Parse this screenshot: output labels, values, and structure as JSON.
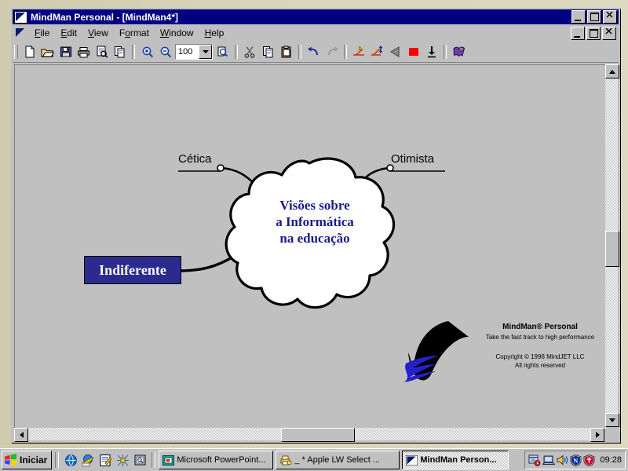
{
  "window": {
    "title": "MindMan Personal - [MindMan4*]",
    "app_icon": "dolphin-icon",
    "buttons": {
      "minimize": "_",
      "maximize": "□",
      "close": "✕"
    }
  },
  "menu": {
    "items": [
      {
        "label": "File",
        "mnemonic": "F"
      },
      {
        "label": "Edit",
        "mnemonic": "E"
      },
      {
        "label": "View",
        "mnemonic": "V"
      },
      {
        "label": "Format",
        "mnemonic": "o"
      },
      {
        "label": "Window",
        "mnemonic": "W"
      },
      {
        "label": "Help",
        "mnemonic": "H"
      }
    ],
    "child_buttons": {
      "minimize": "_",
      "restore": "□",
      "close": "✕"
    }
  },
  "toolbar": {
    "zoom_value": "100",
    "groups": [
      {
        "buttons": [
          {
            "icon": "new-document-icon",
            "tooltip": "New"
          },
          {
            "icon": "open-folder-icon",
            "tooltip": "Open"
          },
          {
            "icon": "save-disk-icon",
            "tooltip": "Save"
          },
          {
            "icon": "print-icon",
            "tooltip": "Print"
          },
          {
            "icon": "print-preview-icon",
            "tooltip": "Print Preview"
          },
          {
            "icon": "copy-pages-icon",
            "tooltip": "Copy"
          }
        ]
      },
      {
        "buttons": [
          {
            "icon": "zoom-in-icon",
            "tooltip": "Zoom In"
          },
          {
            "icon": "zoom-out-icon",
            "tooltip": "Zoom Out"
          },
          {
            "icon": "zoom-combo",
            "tooltip": "Zoom Level"
          },
          {
            "icon": "zoom-selection-icon",
            "tooltip": "Zoom Selection"
          }
        ]
      },
      {
        "buttons": [
          {
            "icon": "cut-scissors-icon",
            "tooltip": "Cut"
          },
          {
            "icon": "copy-icon",
            "tooltip": "Copy"
          },
          {
            "icon": "paste-clipboard-icon",
            "tooltip": "Paste"
          }
        ]
      },
      {
        "buttons": [
          {
            "icon": "undo-arrow-icon",
            "tooltip": "Undo"
          },
          {
            "icon": "redo-arrow-icon",
            "tooltip": "Redo"
          }
        ]
      },
      {
        "buttons": [
          {
            "icon": "insert-branch-icon",
            "tooltip": "Insert Branch"
          },
          {
            "icon": "smart-branch-icon",
            "tooltip": "Smart Branch"
          },
          {
            "icon": "collapse-branch-icon",
            "tooltip": "Collapse"
          },
          {
            "icon": "branch-color-icon",
            "tooltip": "Branch Color"
          },
          {
            "icon": "down-arrow-icon",
            "tooltip": "Insert Below"
          }
        ]
      },
      {
        "buttons": [
          {
            "icon": "help-book-icon",
            "tooltip": "Help"
          }
        ]
      }
    ]
  },
  "map": {
    "central_topic": {
      "name": "central-cloud-topic",
      "lines": [
        "Visões sobre",
        "a Informática",
        "na educação"
      ],
      "text_color": "#1a1a8c",
      "fill": "#ffffff",
      "stroke": "#000000"
    },
    "branches": [
      {
        "name": "branch-cetica",
        "label": "Cética",
        "style": "underline",
        "side": "left-top"
      },
      {
        "name": "branch-otimista",
        "label": "Otimista",
        "style": "underline",
        "side": "right-top"
      },
      {
        "name": "branch-indiferente",
        "label": "Indiferente",
        "style": "filled-box",
        "box_fill": "#2b2b8f",
        "text_color": "#ffffff",
        "side": "left"
      }
    ]
  },
  "watermark": {
    "logo": "dolphin-logo",
    "title": "MindMan® Personal",
    "tagline": "Take the fast track to high performance",
    "copyright": "Copyright © 1998 MindJET LLC",
    "rights": "All rights reserved"
  },
  "scrollbars": {
    "vertical": {
      "up": "▲",
      "down": "▼"
    },
    "horizontal": {
      "left": "◄",
      "right": "►"
    }
  },
  "taskbar": {
    "start_label": "Iniciar",
    "quick_launch": [
      {
        "icon": "globe-icon"
      },
      {
        "icon": "internet-explorer-icon"
      },
      {
        "icon": "notepad-pencil-icon"
      },
      {
        "icon": "network-icon"
      },
      {
        "icon": "screen-icon"
      }
    ],
    "tasks": [
      {
        "label": "Microsoft PowerPoint...",
        "icon": "powerpoint-icon",
        "active": false
      },
      {
        "label": "_ * Apple LW Select ...",
        "icon": "printer-icon",
        "active": false
      },
      {
        "label": "MindMan Person...",
        "icon": "dolphin-icon",
        "active": true
      }
    ],
    "tray": [
      {
        "icon": "scheduler-icon"
      },
      {
        "icon": "display-laptop-icon"
      },
      {
        "icon": "volume-speaker-icon"
      },
      {
        "icon": "norton-shield-icon"
      },
      {
        "icon": "antivirus-shield-icon"
      }
    ],
    "clock": "09:28"
  }
}
